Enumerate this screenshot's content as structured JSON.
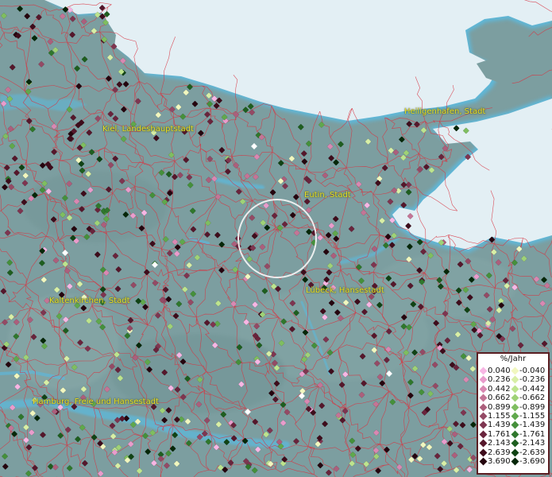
{
  "places": [
    {
      "name": "Heiligenhafen, Stadt"
    },
    {
      "name": "Kiel, Landeshauptstadt"
    },
    {
      "name": "Eutin, Stadt"
    },
    {
      "name": "Lübeck, Hansestadt"
    },
    {
      "name": "Kaltenkirchen, Stadt"
    },
    {
      "name": "Hamburg, Freie und Hansestadt"
    }
  ],
  "legend": {
    "title": "%/Jahr",
    "positive": [
      {
        "label": "0.040",
        "color": "#f7b6e4"
      },
      {
        "label": "0.236",
        "color": "#e99ccc"
      },
      {
        "label": "0.442",
        "color": "#d988b2"
      },
      {
        "label": "0.662",
        "color": "#c47596"
      },
      {
        "label": "0.899",
        "color": "#ac5f7c"
      },
      {
        "label": "1.155",
        "color": "#944a65"
      },
      {
        "label": "1.439",
        "color": "#7e3550"
      },
      {
        "label": "1.761",
        "color": "#69243c"
      },
      {
        "label": "2.143",
        "color": "#55172b"
      },
      {
        "label": "2.639",
        "color": "#3e0c1b"
      },
      {
        "label": "3.690",
        "color": "#25040e"
      }
    ],
    "negative": [
      {
        "label": "-0.040",
        "color": "#f1f7bf"
      },
      {
        "label": "-0.236",
        "color": "#d8efa6"
      },
      {
        "label": "-0.442",
        "color": "#bde48e"
      },
      {
        "label": "-0.662",
        "color": "#9fd277"
      },
      {
        "label": "-0.899",
        "color": "#7fbe60"
      },
      {
        "label": "-1.155",
        "color": "#60a84c"
      },
      {
        "label": "-1.439",
        "color": "#45903b"
      },
      {
        "label": "-1.761",
        "color": "#2f772c"
      },
      {
        "label": "-2.143",
        "color": "#1e5e1f"
      },
      {
        "label": "-2.639",
        "color": "#104314"
      },
      {
        "label": "-3.690",
        "color": "#052708"
      }
    ]
  },
  "colors": {
    "land": "#7c9ea0",
    "sea": "#e1eef3",
    "coast": "#5eb7d8",
    "boundary": "#d8333f",
    "label": "#e8df2a",
    "focus_ring": "#f2f2f2"
  }
}
